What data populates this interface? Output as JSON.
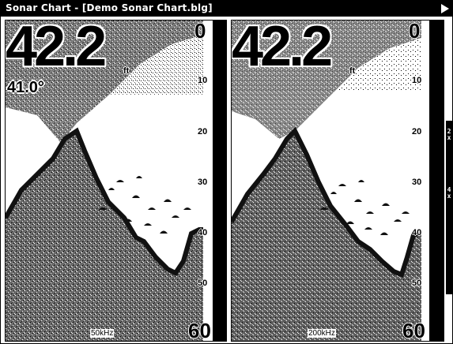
{
  "window": {
    "title": "Sonar Chart - [Demo Sonar Chart.blg]"
  },
  "panels": [
    {
      "depth": "42.2",
      "unit": "ft",
      "temperature": "41.0°",
      "frequency": "50kHz",
      "scale": {
        "top": "0",
        "marks": [
          "10",
          "20",
          "30",
          "40",
          "50"
        ],
        "bottom": "60"
      }
    },
    {
      "depth": "42.2",
      "unit": "ft",
      "frequency": "200kHz",
      "scale": {
        "top": "0",
        "marks": [
          "10",
          "20",
          "30",
          "40",
          "50"
        ],
        "bottom": "60"
      }
    }
  ],
  "zoom": {
    "first": "2x",
    "second": "4x"
  }
}
